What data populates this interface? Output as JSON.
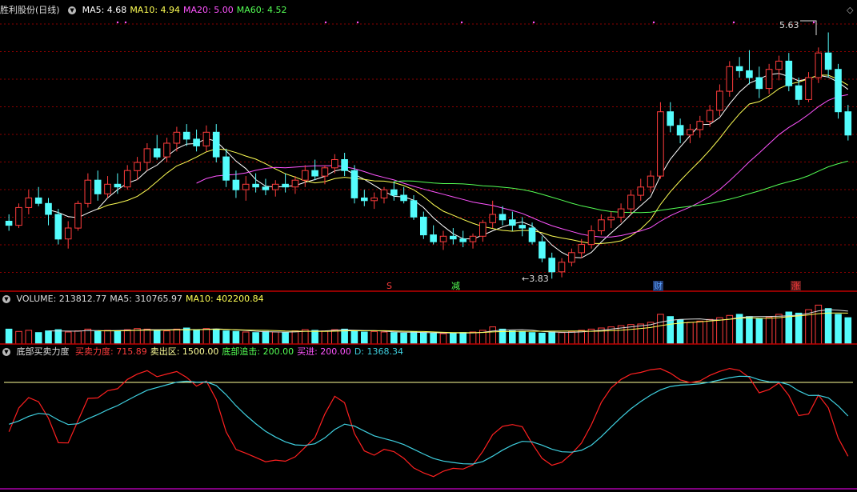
{
  "colors": {
    "up": "#ff3c3c",
    "down": "#54fcfc",
    "ma5": "#ffffff",
    "ma10": "#ffff54",
    "ma20": "#ff54ff",
    "ma60": "#54ff54",
    "grid": "#8b0000",
    "kdj_red": "#ff2020",
    "kdj_cyan": "#3fd0e0",
    "yellow_line": "#ffff99"
  },
  "price_panel": {
    "title": "胜利股份(日线)",
    "legend": [
      {
        "label": "MA5:",
        "value": "4.68",
        "color": "#ffffff"
      },
      {
        "label": "MA10:",
        "value": "4.94",
        "color": "#ffff54"
      },
      {
        "label": "MA20:",
        "value": "5.00",
        "color": "#ff54ff"
      },
      {
        "label": "MA60:",
        "value": "4.52",
        "color": "#54ff54"
      }
    ],
    "high_label": "5.63",
    "low_label": "3.83",
    "markers": [
      {
        "text": "S",
        "color": "#ff3c3c"
      },
      {
        "text": "减",
        "color": "#54ff54"
      },
      {
        "text": "财",
        "color": "#5aa0ff"
      },
      {
        "text": "涨",
        "color": "#ff3c3c"
      }
    ]
  },
  "volume_panel": {
    "legend": [
      {
        "label": "VOLUME:",
        "value": "213812.77",
        "color": "#dddddd"
      },
      {
        "label": "MA5:",
        "value": "310765.97",
        "color": "#dddddd"
      },
      {
        "label": "MA10:",
        "value": "402200.84",
        "color": "#ffff54"
      }
    ]
  },
  "indicator_panel": {
    "title": "底部买卖力度",
    "legend": [
      {
        "label": "买卖力度:",
        "value": "715.89",
        "color": "#ff3c3c"
      },
      {
        "label": "卖出区:",
        "value": "1500.00",
        "color": "#ffff99"
      },
      {
        "label": "底部追击:",
        "value": "200.00",
        "color": "#54ff54"
      },
      {
        "label": "买进:",
        "value": "200.00",
        "color": "#ff54ff"
      },
      {
        "label": "D:",
        "value": "1368.34",
        "color": "#3fd0e0"
      }
    ]
  },
  "chart_data": {
    "type": "candlestick",
    "candles": [
      [
        4.25,
        4.3,
        4.18,
        4.22
      ],
      [
        4.22,
        4.38,
        4.2,
        4.35
      ],
      [
        4.35,
        4.48,
        4.3,
        4.42
      ],
      [
        4.42,
        4.5,
        4.36,
        4.38
      ],
      [
        4.38,
        4.42,
        4.22,
        4.3
      ],
      [
        4.3,
        4.34,
        4.08,
        4.12
      ],
      [
        4.12,
        4.25,
        4.05,
        4.2
      ],
      [
        4.2,
        4.4,
        4.18,
        4.38
      ],
      [
        4.38,
        4.6,
        4.35,
        4.55
      ],
      [
        4.55,
        4.62,
        4.4,
        4.45
      ],
      [
        4.45,
        4.58,
        4.42,
        4.52
      ],
      [
        4.52,
        4.6,
        4.45,
        4.5
      ],
      [
        4.5,
        4.66,
        4.48,
        4.62
      ],
      [
        4.62,
        4.72,
        4.55,
        4.68
      ],
      [
        4.68,
        4.82,
        4.62,
        4.78
      ],
      [
        4.78,
        4.88,
        4.7,
        4.72
      ],
      [
        4.72,
        4.86,
        4.68,
        4.82
      ],
      [
        4.82,
        4.94,
        4.76,
        4.9
      ],
      [
        4.9,
        4.96,
        4.8,
        4.85
      ],
      [
        4.85,
        4.92,
        4.76,
        4.8
      ],
      [
        4.8,
        4.95,
        4.76,
        4.9
      ],
      [
        4.9,
        4.96,
        4.68,
        4.72
      ],
      [
        4.72,
        4.78,
        4.5,
        4.55
      ],
      [
        4.55,
        4.62,
        4.42,
        4.48
      ],
      [
        4.48,
        4.58,
        4.4,
        4.52
      ],
      [
        4.52,
        4.6,
        4.46,
        4.5
      ],
      [
        4.5,
        4.56,
        4.44,
        4.48
      ],
      [
        4.48,
        4.55,
        4.43,
        4.52
      ],
      [
        4.52,
        4.6,
        4.46,
        4.5
      ],
      [
        4.5,
        4.58,
        4.45,
        4.55
      ],
      [
        4.55,
        4.66,
        4.5,
        4.62
      ],
      [
        4.62,
        4.7,
        4.55,
        4.58
      ],
      [
        4.58,
        4.66,
        4.52,
        4.64
      ],
      [
        4.64,
        4.74,
        4.6,
        4.7
      ],
      [
        4.7,
        4.75,
        4.58,
        4.62
      ],
      [
        4.62,
        4.66,
        4.38,
        4.42
      ],
      [
        4.42,
        4.48,
        4.36,
        4.4
      ],
      [
        4.4,
        4.46,
        4.34,
        4.42
      ],
      [
        4.42,
        4.5,
        4.38,
        4.48
      ],
      [
        4.48,
        4.54,
        4.4,
        4.44
      ],
      [
        4.44,
        4.5,
        4.38,
        4.4
      ],
      [
        4.4,
        4.44,
        4.26,
        4.28
      ],
      [
        4.28,
        4.32,
        4.12,
        4.15
      ],
      [
        4.15,
        4.22,
        4.08,
        4.1
      ],
      [
        4.1,
        4.18,
        4.04,
        4.14
      ],
      [
        4.14,
        4.2,
        4.08,
        4.12
      ],
      [
        4.12,
        4.18,
        4.06,
        4.1
      ],
      [
        4.1,
        4.16,
        4.05,
        4.14
      ],
      [
        4.14,
        4.26,
        4.1,
        4.24
      ],
      [
        4.24,
        4.4,
        4.2,
        4.3
      ],
      [
        4.3,
        4.36,
        4.22,
        4.26
      ],
      [
        4.26,
        4.32,
        4.18,
        4.22
      ],
      [
        4.22,
        4.28,
        4.14,
        4.2
      ],
      [
        4.2,
        4.24,
        4.08,
        4.1
      ],
      [
        4.1,
        4.14,
        3.95,
        3.98
      ],
      [
        3.98,
        4.02,
        3.83,
        3.88
      ],
      [
        3.88,
        3.98,
        3.84,
        3.95
      ],
      [
        3.95,
        4.05,
        3.92,
        4.02
      ],
      [
        4.02,
        4.12,
        3.98,
        4.08
      ],
      [
        4.08,
        4.22,
        4.05,
        4.18
      ],
      [
        4.18,
        4.3,
        4.15,
        4.26
      ],
      [
        4.26,
        4.32,
        4.2,
        4.28
      ],
      [
        4.28,
        4.38,
        4.24,
        4.34
      ],
      [
        4.34,
        4.48,
        4.3,
        4.44
      ],
      [
        4.44,
        4.56,
        4.4,
        4.5
      ],
      [
        4.5,
        4.62,
        4.46,
        4.58
      ],
      [
        4.58,
        5.12,
        4.56,
        5.05
      ],
      [
        5.05,
        5.12,
        4.9,
        4.95
      ],
      [
        4.95,
        5.0,
        4.82,
        4.88
      ],
      [
        4.88,
        4.96,
        4.82,
        4.92
      ],
      [
        4.92,
        5.02,
        4.86,
        4.98
      ],
      [
        4.98,
        5.1,
        4.94,
        5.06
      ],
      [
        5.06,
        5.25,
        5.02,
        5.2
      ],
      [
        5.2,
        5.42,
        5.16,
        5.38
      ],
      [
        5.38,
        5.45,
        5.3,
        5.35
      ],
      [
        5.35,
        5.5,
        5.25,
        5.3
      ],
      [
        5.3,
        5.38,
        5.15,
        5.22
      ],
      [
        5.22,
        5.4,
        5.18,
        5.36
      ],
      [
        5.36,
        5.46,
        5.28,
        5.42
      ],
      [
        5.42,
        5.48,
        5.2,
        5.24
      ],
      [
        5.24,
        5.3,
        5.1,
        5.14
      ],
      [
        5.14,
        5.34,
        5.12,
        5.3
      ],
      [
        5.3,
        5.52,
        5.26,
        5.48
      ],
      [
        5.48,
        5.63,
        5.3,
        5.36
      ],
      [
        5.36,
        5.4,
        5.0,
        5.05
      ],
      [
        5.05,
        5.1,
        4.84,
        4.88
      ]
    ],
    "volume": [
      260,
      220,
      240,
      200,
      230,
      250,
      210,
      230,
      260,
      220,
      240,
      230,
      250,
      270,
      260,
      240,
      230,
      260,
      280,
      250,
      270,
      260,
      230,
      220,
      210,
      200,
      220,
      210,
      200,
      230,
      250,
      240,
      230,
      250,
      260,
      230,
      210,
      220,
      210,
      200,
      190,
      210,
      200,
      190,
      180,
      190,
      200,
      210,
      240,
      300,
      260,
      230,
      220,
      200,
      190,
      210,
      200,
      220,
      240,
      260,
      280,
      300,
      320,
      340,
      350,
      380,
      520,
      480,
      420,
      380,
      400,
      430,
      460,
      500,
      520,
      480,
      440,
      470,
      520,
      560,
      540,
      600,
      680,
      620,
      520,
      460
    ],
    "y_range": [
      3.75,
      5.75
    ]
  }
}
